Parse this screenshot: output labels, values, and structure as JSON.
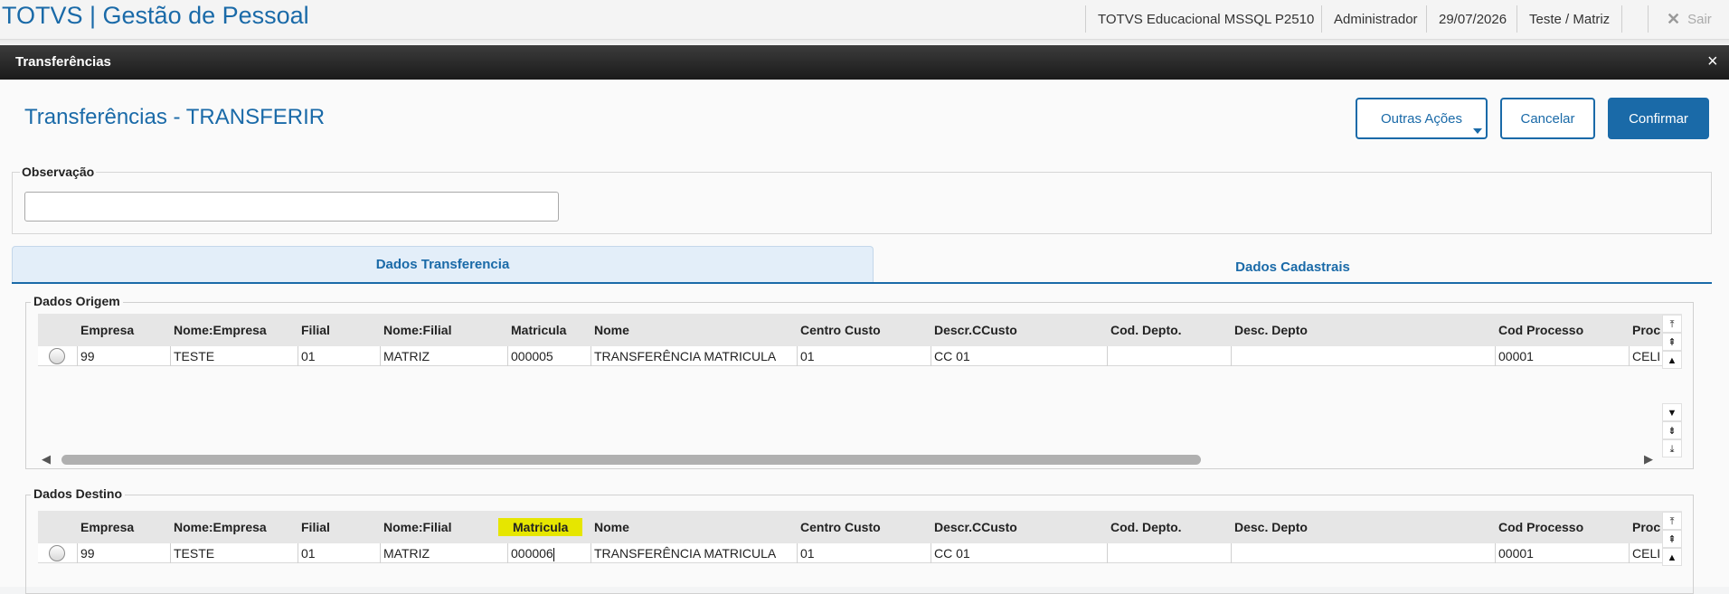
{
  "app": {
    "title": "TOTVS | Gestão de Pessoal"
  },
  "topbar": {
    "environment": "TOTVS Educacional MSSQL P2510",
    "user": "Administrador",
    "date": "29/07/2026",
    "branch": "Teste / Matriz",
    "logout_label": "Sair"
  },
  "dialog": {
    "title": "Transferências",
    "close_glyph": "×"
  },
  "page": {
    "title": "Transferências - TRANSFERIR",
    "buttons": {
      "other_actions": "Outras Ações",
      "cancel": "Cancelar",
      "confirm": "Confirmar"
    }
  },
  "observacao": {
    "label": "Observação",
    "value": ""
  },
  "tabs": [
    {
      "label": "Dados Transferencia",
      "active": true
    },
    {
      "label": "Dados Cadastrais",
      "active": false
    }
  ],
  "origem": {
    "label": "Dados Origem",
    "columns": [
      "Empresa",
      "Nome:Empresa",
      "Filial",
      "Nome:Filial",
      "Matricula",
      "Nome",
      "Centro Custo",
      "Descr.CCusto",
      "Cod. Depto.",
      "Desc. Depto",
      "Cod Processo",
      "Proc"
    ],
    "rows": [
      [
        "99",
        "TESTE",
        "01",
        "MATRIZ",
        "000005",
        "TRANSFERÊNCIA MATRICULA",
        "01",
        "CC 01",
        "",
        "",
        "00001",
        "CELI"
      ]
    ]
  },
  "destino": {
    "label": "Dados Destino",
    "columns": [
      "Empresa",
      "Nome:Empresa",
      "Filial",
      "Nome:Filial",
      "Matricula",
      "Nome",
      "Centro Custo",
      "Descr.CCusto",
      "Cod. Depto.",
      "Desc. Depto",
      "Cod Processo",
      "Proc"
    ],
    "highlighted_column": "Matricula",
    "rows": [
      [
        "99",
        "TESTE",
        "01",
        "MATRIZ",
        "000006",
        "TRANSFERÊNCIA MATRICULA",
        "01",
        "CC 01",
        "",
        "",
        "00001",
        "CELI"
      ]
    ]
  },
  "scroll_icons": {
    "top": "⤒",
    "up_fast": "⇞",
    "up": "▲",
    "down": "▼",
    "down_fast": "⇟",
    "bottom": "⤓",
    "left": "◀",
    "right": "▶"
  },
  "colors": {
    "brand": "#1a6aa8",
    "highlight": "#e6e600"
  }
}
